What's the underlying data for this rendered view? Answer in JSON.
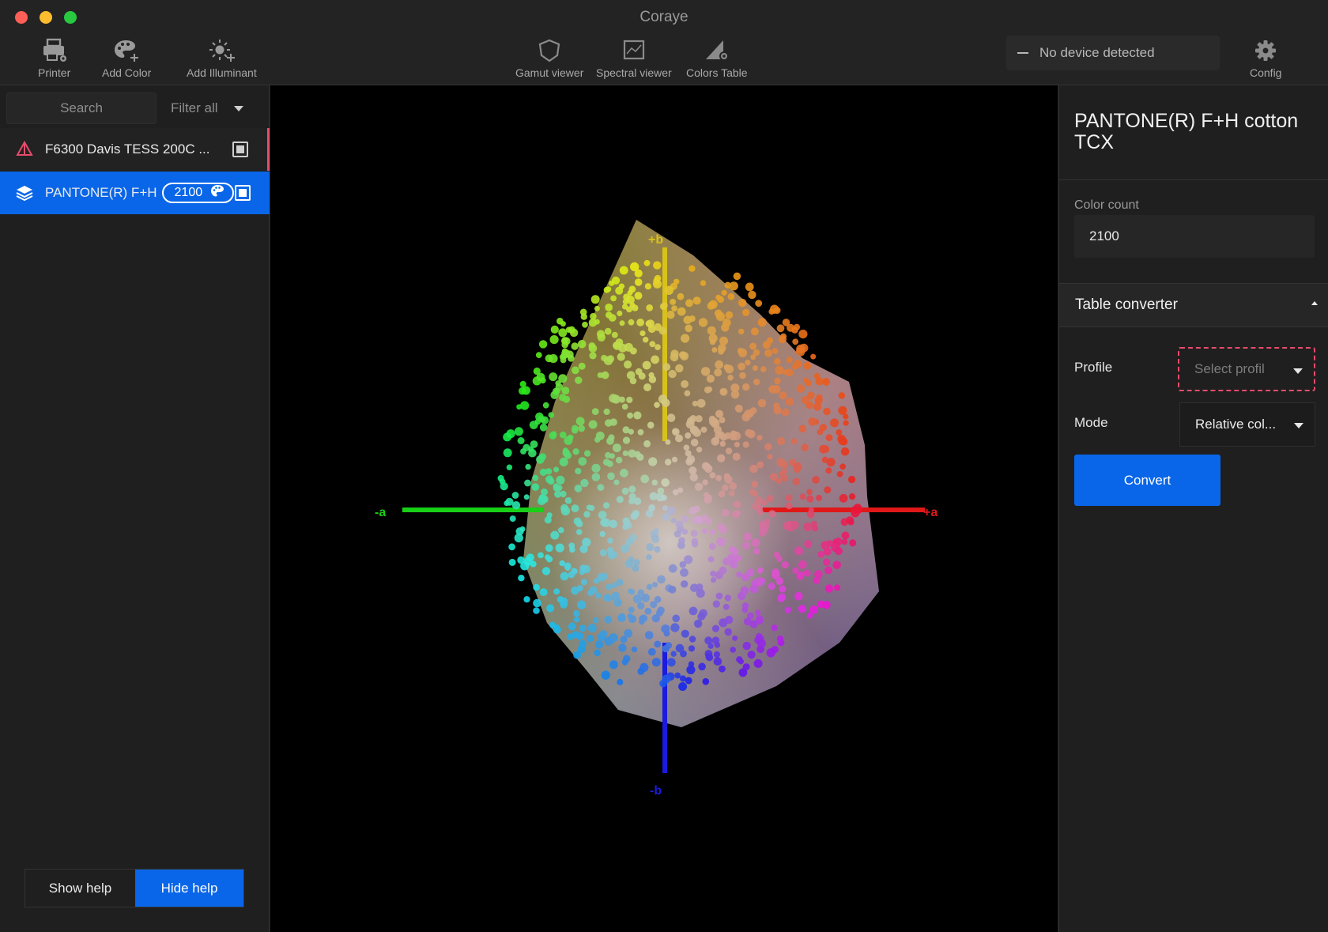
{
  "window": {
    "title": "Coraye"
  },
  "toolbar": {
    "printer": "Printer",
    "add_color": "Add Color",
    "add_illuminant": "Add Illuminant",
    "gamut_viewer": "Gamut viewer",
    "spectral_viewer": "Spectral viewer",
    "colors_table": "Colors Table",
    "config": "Config"
  },
  "device": {
    "status": "No device detected"
  },
  "sidebar": {
    "search_placeholder": "Search",
    "filter_label": "Filter all",
    "items": [
      {
        "label": "F6300 Davis TESS 200C ...",
        "icon": "printer-profile-icon",
        "selected": false
      },
      {
        "label": "PANTONE(R) F+H",
        "icon": "layers-icon",
        "count": "2100",
        "selected": true
      }
    ],
    "help": {
      "show": "Show help",
      "hide": "Hide help"
    }
  },
  "viewer": {
    "axes": {
      "plus_a": "+a",
      "minus_a": "-a",
      "plus_b": "+b",
      "minus_b": "-b"
    },
    "colors": {
      "a_plus": "#e01818",
      "a_minus": "#17d017",
      "b_plus": "#d8c21a",
      "b_minus": "#1a1ae0"
    }
  },
  "panel": {
    "title": "PANTONE(R) F+H cotton TCX",
    "color_count_label": "Color count",
    "color_count_value": "2100",
    "table_converter": "Table converter",
    "profile_label": "Profile",
    "profile_placeholder": "Select profil",
    "mode_label": "Mode",
    "mode_value": "Relative col...",
    "convert": "Convert"
  },
  "colors": {
    "accent": "#0a66e8",
    "alert": "#e54d6b"
  }
}
